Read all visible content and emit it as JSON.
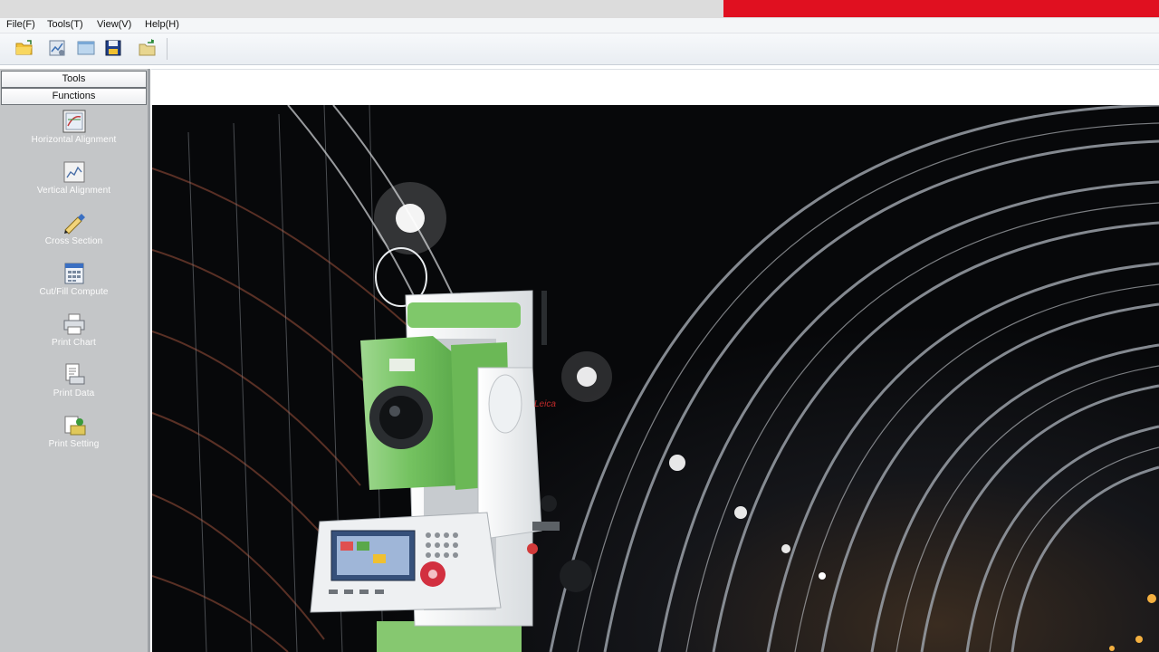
{
  "menu": {
    "items": [
      {
        "label": "File(F)"
      },
      {
        "label": "Tools(T)"
      },
      {
        "label": "View(V)"
      },
      {
        "label": "Help(H)"
      }
    ]
  },
  "toolbar": {
    "buttons": [
      {
        "icon": "open-folder-icon"
      },
      {
        "icon": "settings-chart-icon"
      },
      {
        "icon": "window-icon"
      },
      {
        "icon": "save-icon"
      },
      {
        "icon": "export-folder-icon"
      }
    ]
  },
  "left_panel": {
    "tools_label": "Tools",
    "functions_label": "Functions",
    "functions": [
      {
        "label": "Horizontal Alignment",
        "icon": "horizontal-alignment-icon"
      },
      {
        "label": "Vertical Alignment",
        "icon": "vertical-alignment-icon"
      },
      {
        "label": "Cross Section",
        "icon": "cross-section-icon"
      },
      {
        "label": "Cut/Fill Compute",
        "icon": "calculator-icon"
      },
      {
        "label": "Print Chart",
        "icon": "printer-icon"
      },
      {
        "label": "Print Data",
        "icon": "print-data-icon"
      },
      {
        "label": "Print Setting",
        "icon": "print-setting-icon"
      }
    ]
  },
  "banner": {
    "image": "tunnel-total-station-photo",
    "device_brand": "Leica"
  },
  "colors": {
    "accent": "#e01020",
    "panel_bg": "#c4c6c8",
    "device_green": "#7dc868"
  }
}
